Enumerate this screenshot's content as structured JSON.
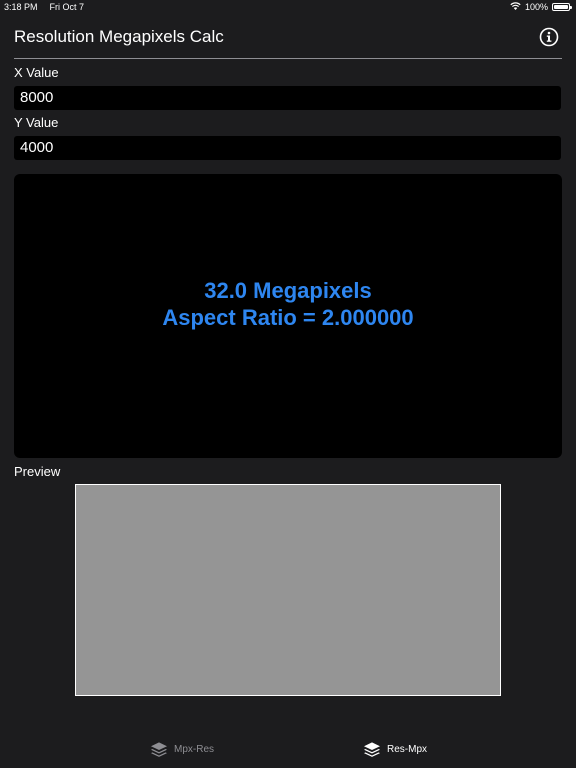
{
  "status_bar": {
    "time": "3:18 PM",
    "date": "Fri Oct 7",
    "battery": "100%"
  },
  "header": {
    "title": "Resolution Megapixels Calc"
  },
  "fields": {
    "x_label": "X Value",
    "x_value": "8000",
    "y_label": "Y Value",
    "y_value": "4000"
  },
  "result": {
    "megapixels": "32.0 Megapixels",
    "aspect_ratio": "Aspect Ratio = 2.000000",
    "color": "#2e86f0"
  },
  "preview": {
    "label": "Preview",
    "fill_color": "#959595"
  },
  "tabs": [
    {
      "label": "Mpx-Res",
      "icon": "layers-icon",
      "selected": false
    },
    {
      "label": "Res-Mpx",
      "icon": "layers-icon",
      "selected": true
    }
  ]
}
